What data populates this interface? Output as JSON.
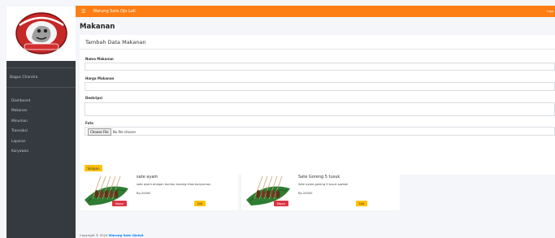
{
  "app": {
    "title": "Warung Sate Ojo Lali",
    "topbar_right": "Logo"
  },
  "sidebar": {
    "user_name": "Bagus Chandra",
    "items": [
      {
        "label": "Dashboard"
      },
      {
        "label": "Makanan"
      },
      {
        "label": "Minuman"
      },
      {
        "label": "Transaksi"
      },
      {
        "label": "Laporan"
      },
      {
        "label": "Karyawan"
      }
    ]
  },
  "page": {
    "title": "Makanan"
  },
  "form": {
    "header": "Tambah Data Makanan",
    "name_label": "Nama Makanan",
    "name_value": "",
    "price_label": "Harga Makanan",
    "price_value": "",
    "desc_label": "Deskripsi",
    "desc_value": "",
    "photo_label": "Foto",
    "file_button": "Choose File",
    "file_status": "No file chosen",
    "submit_label": "Simpan"
  },
  "products": [
    {
      "name": "sate ayam",
      "description": "sate ayam dnegan bumbu kacang khas banyumas",
      "price": "Rp.20000",
      "delete_label": "Hapus",
      "edit_label": "Edit"
    },
    {
      "name": "Sate Goreng 5 tusuk",
      "description": "Sate ayam goreng 5 tusuk spesial",
      "price": "Rp.20000",
      "delete_label": "Hapus",
      "edit_label": "Edit"
    }
  ],
  "footer": {
    "prefix": "Copyright © 2024 ",
    "brand": "Warung Sate Ojolali."
  },
  "colors": {
    "topbar": "#fd7e14",
    "sidebar": "#343a40",
    "primary": "#ffc107",
    "danger": "#dc3545",
    "link": "#007bff"
  },
  "icons": {
    "menu": "hamburger-icon",
    "brand": "restaurant-logo"
  }
}
